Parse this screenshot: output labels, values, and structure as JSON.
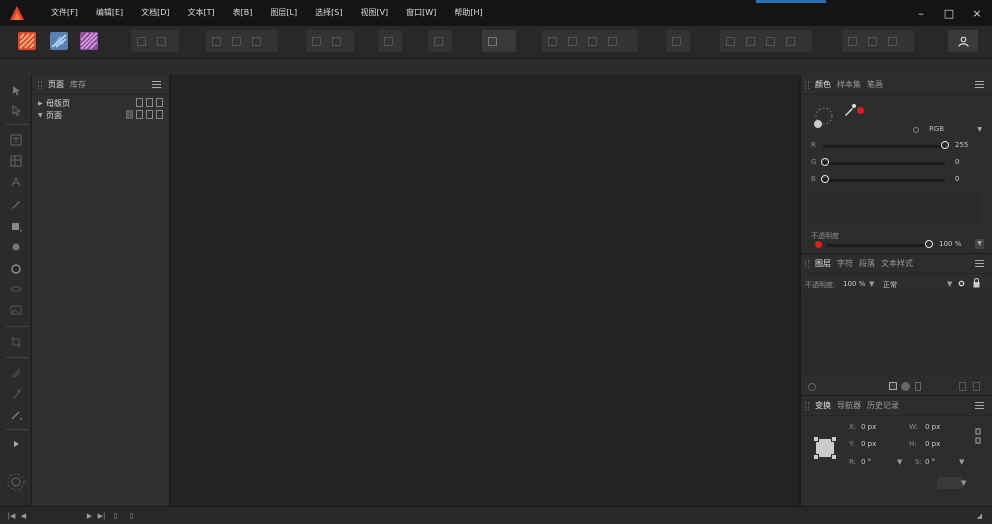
{
  "menu": {
    "items": [
      "文件[F]",
      "编辑[E]",
      "文档[D]",
      "文本[T]",
      "表[B]",
      "图层[L]",
      "选择[S]",
      "视图[V]",
      "窗口[W]",
      "帮助[H]"
    ]
  },
  "window": {
    "minimize": "–",
    "maximize": "□",
    "close": "×"
  },
  "colors": {
    "accent": "#2b6fb2",
    "brand": "#e5432d",
    "pink": "#ff5a6e"
  },
  "pages_panel": {
    "tabs": [
      "页面",
      "库存"
    ],
    "tree": [
      {
        "label": "母版页",
        "expanded": false
      },
      {
        "label": "页面",
        "expanded": true
      }
    ]
  },
  "color_panel": {
    "tabs": [
      "颜色",
      "样本集",
      "笔画"
    ],
    "model": "RGB",
    "channels": [
      {
        "label": "R",
        "value": "255",
        "level": 1.0
      },
      {
        "label": "G",
        "value": "0",
        "level": 0.0
      },
      {
        "label": "B",
        "value": "0",
        "level": 0.0
      }
    ],
    "opacity_label": "不透明度",
    "opacity_value": "100 %"
  },
  "layers_panel": {
    "tabs": [
      "图层",
      "字符",
      "段落",
      "文本样式"
    ],
    "opacity_label": "不透明度:",
    "opacity_value": "100 %",
    "blend_mode": "正常"
  },
  "transform_panel": {
    "tabs": [
      "变换",
      "导航器",
      "历史记录"
    ],
    "x_label": "X:",
    "x_value": "0 px",
    "y_label": "Y:",
    "y_value": "0 px",
    "w_label": "W:",
    "w_value": "0 px",
    "h_label": "H:",
    "h_value": "0 px",
    "r_label": "R:",
    "r_value": "0 °",
    "s_label": "S:",
    "s_value": "0 °"
  }
}
